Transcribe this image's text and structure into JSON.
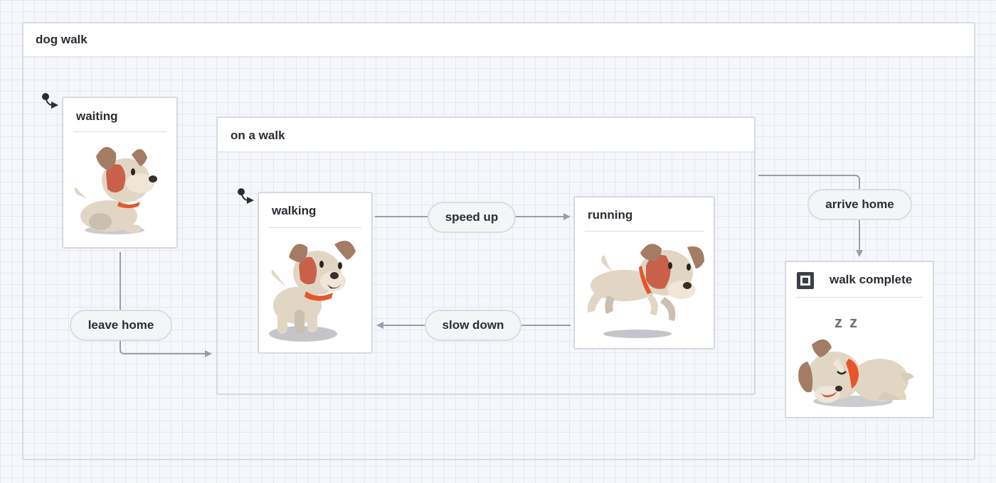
{
  "machine": {
    "title": "dog walk"
  },
  "states": {
    "waiting": {
      "title": "waiting",
      "initial": true
    },
    "on_a_walk": {
      "title": "on a walk"
    },
    "walking": {
      "title": "walking",
      "initial": true
    },
    "running": {
      "title": "running"
    },
    "walk_complete": {
      "title": "walk complete",
      "final": true
    }
  },
  "transitions": {
    "leave_home": "leave home",
    "speed_up": "speed up",
    "slow_down": "slow down",
    "arrive_home": "arrive home"
  },
  "illustration": {
    "sleep_text": "z z"
  },
  "colors": {
    "arrow": "#9b9ea6",
    "dog_body": "#e1d6c4",
    "dog_ear": "#a47b64",
    "dog_patch": "#c9614a",
    "collar": "#e5562a",
    "shadow": "#b4b6ba"
  }
}
